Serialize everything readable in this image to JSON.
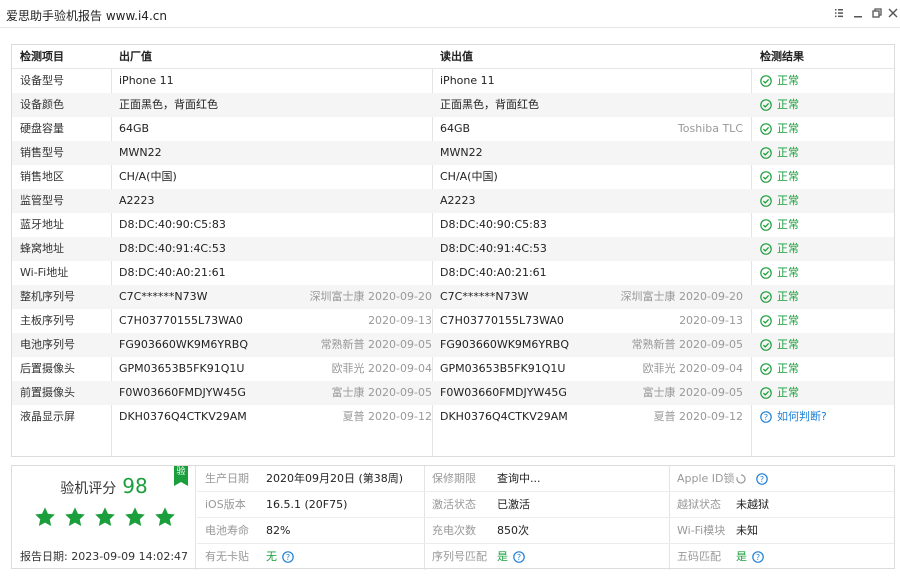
{
  "window": {
    "title": "爱思助手验机报告 www.i4.cn"
  },
  "table": {
    "headers": [
      "检测项目",
      "出厂值",
      "读出值",
      "检测结果"
    ],
    "rows": [
      {
        "item": "设备型号",
        "factory": "iPhone 11",
        "factory_meta": "",
        "read": "iPhone 11",
        "read_meta": "",
        "result": "正常",
        "result_type": "ok"
      },
      {
        "item": "设备颜色",
        "factory": "正面黑色，背面红色",
        "factory_meta": "",
        "read": "正面黑色，背面红色",
        "read_meta": "",
        "result": "正常",
        "result_type": "ok"
      },
      {
        "item": "硬盘容量",
        "factory": "64GB",
        "factory_meta": "",
        "read": "64GB",
        "read_meta": "Toshiba TLC",
        "result": "正常",
        "result_type": "ok"
      },
      {
        "item": "销售型号",
        "factory": "MWN22",
        "factory_meta": "",
        "read": "MWN22",
        "read_meta": "",
        "result": "正常",
        "result_type": "ok"
      },
      {
        "item": "销售地区",
        "factory": "CH/A(中国)",
        "factory_meta": "",
        "read": "CH/A(中国)",
        "read_meta": "",
        "result": "正常",
        "result_type": "ok"
      },
      {
        "item": "监管型号",
        "factory": "A2223",
        "factory_meta": "",
        "read": "A2223",
        "read_meta": "",
        "result": "正常",
        "result_type": "ok"
      },
      {
        "item": "蓝牙地址",
        "factory": "D8:DC:40:90:C5:83",
        "factory_meta": "",
        "read": "D8:DC:40:90:C5:83",
        "read_meta": "",
        "result": "正常",
        "result_type": "ok"
      },
      {
        "item": "蜂窝地址",
        "factory": "D8:DC:40:91:4C:53",
        "factory_meta": "",
        "read": "D8:DC:40:91:4C:53",
        "read_meta": "",
        "result": "正常",
        "result_type": "ok"
      },
      {
        "item": "Wi-Fi地址",
        "factory": "D8:DC:40:A0:21:61",
        "factory_meta": "",
        "read": "D8:DC:40:A0:21:61",
        "read_meta": "",
        "result": "正常",
        "result_type": "ok"
      },
      {
        "item": "整机序列号",
        "factory": "C7C******N73W",
        "factory_meta": "深圳富士康 2020-09-20",
        "read": "C7C******N73W",
        "read_meta": "深圳富士康 2020-09-20",
        "result": "正常",
        "result_type": "ok"
      },
      {
        "item": "主板序列号",
        "factory": "C7H03770155L73WA0",
        "factory_meta": "2020-09-13",
        "read": "C7H03770155L73WA0",
        "read_meta": "2020-09-13",
        "result": "正常",
        "result_type": "ok"
      },
      {
        "item": "电池序列号",
        "factory": "FG903660WK9M6YRBQ",
        "factory_meta": "常熟新普 2020-09-05",
        "read": "FG903660WK9M6YRBQ",
        "read_meta": "常熟新普 2020-09-05",
        "result": "正常",
        "result_type": "ok"
      },
      {
        "item": "后置摄像头",
        "factory": "GPM03653B5FK91Q1U",
        "factory_meta": "欧菲光 2020-09-04",
        "read": "GPM03653B5FK91Q1U",
        "read_meta": "欧菲光 2020-09-04",
        "result": "正常",
        "result_type": "ok"
      },
      {
        "item": "前置摄像头",
        "factory": "F0W03660FMDJYW45G",
        "factory_meta": "富士康 2020-09-05",
        "read": "F0W03660FMDJYW45G",
        "read_meta": "富士康 2020-09-05",
        "result": "正常",
        "result_type": "ok"
      },
      {
        "item": "液晶显示屏",
        "factory": "DKH0376Q4CTKV29AM",
        "factory_meta": "夏普 2020-09-12",
        "read": "DKH0376Q4CTKV29AM",
        "read_meta": "夏普 2020-09-12",
        "result": "如何判断?",
        "result_type": "help"
      }
    ]
  },
  "summary": {
    "score_label": "验机评分",
    "score": "98",
    "badge": "验",
    "stars": 5,
    "report_date_label": "报告日期:",
    "report_date": "2023-09-09 14:02:47",
    "rows": [
      [
        {
          "label": "生产日期",
          "value": "2020年09月20日 (第38周)",
          "green": false,
          "help": false
        },
        {
          "label": "保修期限",
          "value": "查询中...",
          "green": false,
          "help": false
        },
        {
          "label": "Apple ID锁",
          "value": "",
          "green": false,
          "help": true,
          "spinner": true
        }
      ],
      [
        {
          "label": "iOS版本",
          "value": "16.5.1 (20F75)",
          "green": false,
          "help": false
        },
        {
          "label": "激活状态",
          "value": "已激活",
          "green": false,
          "help": false
        },
        {
          "label": "越狱状态",
          "value": "未越狱",
          "green": false,
          "help": false
        }
      ],
      [
        {
          "label": "电池寿命",
          "value": "82%",
          "green": false,
          "help": false
        },
        {
          "label": "充电次数",
          "value": "850次",
          "green": false,
          "help": false
        },
        {
          "label": "Wi-Fi模块",
          "value": "未知",
          "green": false,
          "help": false
        }
      ],
      [
        {
          "label": "有无卡贴",
          "value": "无",
          "green": true,
          "help": true
        },
        {
          "label": "序列号匹配",
          "value": "是",
          "green": true,
          "help": true
        },
        {
          "label": "五码匹配",
          "value": "是",
          "green": true,
          "help": true
        }
      ]
    ]
  },
  "colors": {
    "ok": "#1a9f3c",
    "link": "#1e7fd6",
    "muted": "#999999"
  }
}
